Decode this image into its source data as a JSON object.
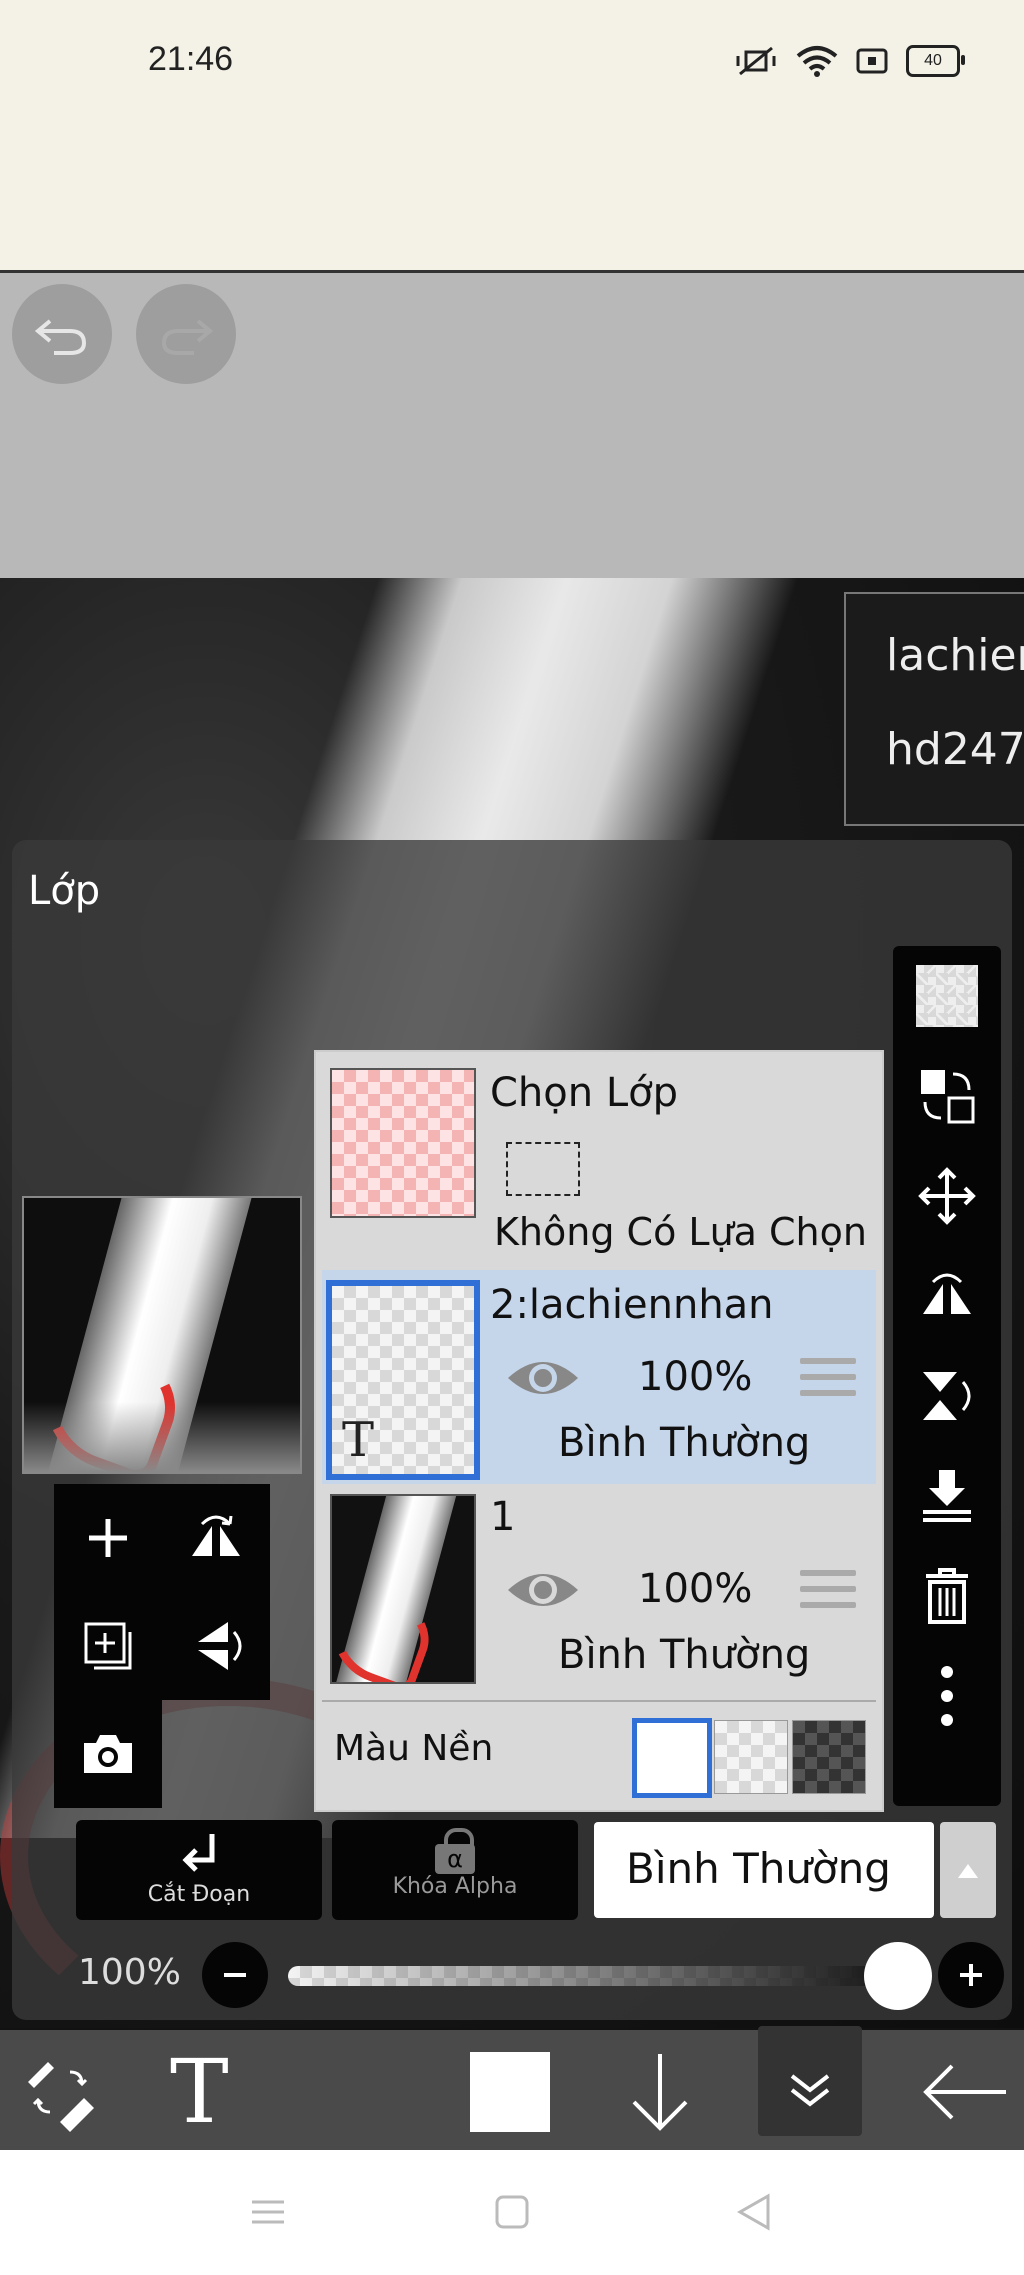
{
  "status_bar": {
    "time": "21:46",
    "battery": "40"
  },
  "canvas": {
    "text_lines": [
      "lachien",
      "hd247"
    ]
  },
  "layer_panel": {
    "title": "Lớp",
    "selection_layer": {
      "title": "Chọn Lớp",
      "subtitle": "Không Có Lựa Chọn"
    },
    "layers": [
      {
        "name": "2:lachiennhan",
        "opacity": "100%",
        "blend": "Bình Thường",
        "selected": true,
        "type_glyph": "T"
      },
      {
        "name": "1",
        "opacity": "100%",
        "blend": "Bình Thường",
        "selected": false
      }
    ],
    "background_label": "Màu Nền"
  },
  "bottom_buttons": {
    "clipping": "Cắt Đoạn",
    "alpha_lock": "Khóa Alpha",
    "alpha_glyph": "α",
    "blend_mode": "Bình Thường"
  },
  "opacity": {
    "label": "100%",
    "value": 1.0
  },
  "bottom_toolbar": {
    "text_tool": "T"
  },
  "colors": {
    "accent_blue": "#2f6fd6",
    "selected_row": "#c5d5ea",
    "panel": "#3a3a3a"
  }
}
